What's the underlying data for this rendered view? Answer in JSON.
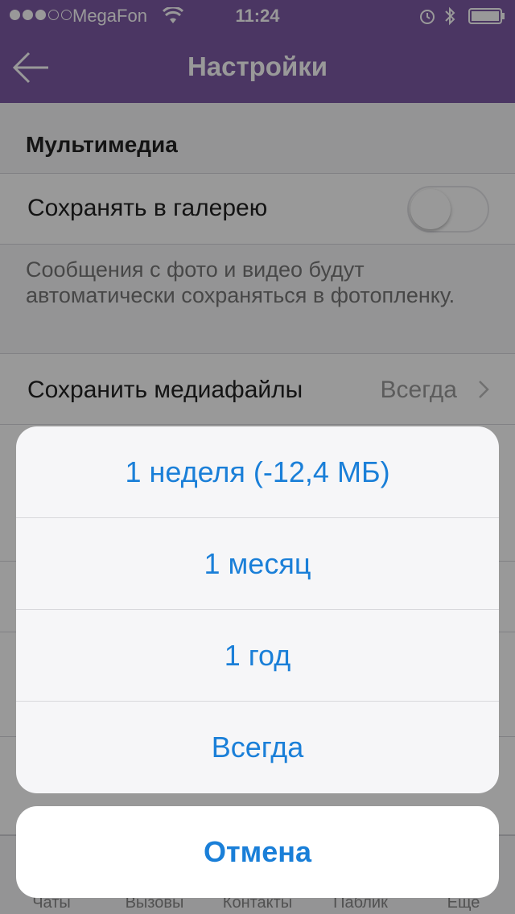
{
  "status_bar": {
    "carrier": "MegaFon",
    "time": "11:24",
    "signal_bars_filled": 3,
    "signal_bars_total": 5
  },
  "nav": {
    "title": "Настройки",
    "back_icon": "back-arrow-icon"
  },
  "section": {
    "title": "Мультимедиа"
  },
  "gallery_row": {
    "label": "Сохранять в галерею",
    "toggle_on": false
  },
  "gallery_description": "Сообщения с фото и видео будут автоматически сохраняться в фотопленку.",
  "media_row": {
    "label": "Сохранить медиафайлы",
    "value": "Всегда"
  },
  "action_sheet": {
    "options": [
      "1 неделя (-12,4 МБ)",
      "1 месяц",
      "1 год",
      "Всегда"
    ],
    "cancel": "Отмена"
  },
  "tabs": [
    "Чаты",
    "Вызовы",
    "Контакты",
    "Паблик",
    "Еще"
  ],
  "colors": {
    "nav_purple": "#7d5ba6",
    "action_blue": "#1a7fd8"
  }
}
